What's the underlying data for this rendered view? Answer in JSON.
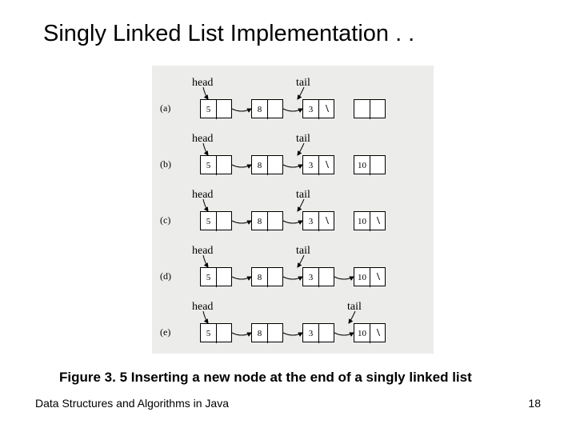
{
  "title": "Singly Linked List Implementation . .",
  "caption": "Figure 3. 5 Inserting a new node at the end of a singly linked list",
  "footer_left": "Data Structures and Algorithms in Java",
  "footer_right": "18",
  "labels": {
    "head_a": "head",
    "tail_a": "tail",
    "head_b": "head",
    "tail_b": "tail",
    "head_c": "head",
    "tail_c": "tail",
    "head_d": "head",
    "tail_d": "tail",
    "head_e": "head",
    "tail_e": "tail"
  },
  "rows": [
    {
      "tag": "(a)",
      "nodes": [
        {
          "v": "5",
          "n": ""
        },
        {
          "v": "8",
          "n": ""
        },
        {
          "v": "3",
          "n": "\\"
        },
        {
          "v": "",
          "n": ""
        }
      ],
      "head_at": 0,
      "tail_at": 2
    },
    {
      "tag": "(b)",
      "nodes": [
        {
          "v": "5",
          "n": ""
        },
        {
          "v": "8",
          "n": ""
        },
        {
          "v": "3",
          "n": "\\"
        },
        {
          "v": "10",
          "n": ""
        }
      ],
      "head_at": 0,
      "tail_at": 2
    },
    {
      "tag": "(c)",
      "nodes": [
        {
          "v": "5",
          "n": ""
        },
        {
          "v": "8",
          "n": ""
        },
        {
          "v": "3",
          "n": "\\"
        },
        {
          "v": "10",
          "n": "\\"
        }
      ],
      "head_at": 0,
      "tail_at": 2
    },
    {
      "tag": "(d)",
      "nodes": [
        {
          "v": "5",
          "n": ""
        },
        {
          "v": "8",
          "n": ""
        },
        {
          "v": "3",
          "n": ""
        },
        {
          "v": "10",
          "n": "\\"
        }
      ],
      "head_at": 0,
      "tail_at": 2
    },
    {
      "tag": "(e)",
      "nodes": [
        {
          "v": "5",
          "n": ""
        },
        {
          "v": "8",
          "n": ""
        },
        {
          "v": "3",
          "n": ""
        },
        {
          "v": "10",
          "n": "\\"
        }
      ],
      "head_at": 0,
      "tail_at": 3
    }
  ],
  "chart_data": {
    "type": "table",
    "title": "Figure 3.5 Inserting a new node at the end of a singly linked list",
    "series": [
      {
        "name": "(a)",
        "values": [
          5,
          8,
          3,
          null
        ],
        "head": "node0",
        "tail": "node2",
        "null_next": [
          "node2"
        ]
      },
      {
        "name": "(b)",
        "values": [
          5,
          8,
          3,
          10
        ],
        "head": "node0",
        "tail": "node2",
        "null_next": [
          "node2"
        ]
      },
      {
        "name": "(c)",
        "values": [
          5,
          8,
          3,
          10
        ],
        "head": "node0",
        "tail": "node2",
        "null_next": [
          "node2",
          "node3"
        ]
      },
      {
        "name": "(d)",
        "values": [
          5,
          8,
          3,
          10
        ],
        "head": "node0",
        "tail": "node2",
        "null_next": [
          "node3"
        ]
      },
      {
        "name": "(e)",
        "values": [
          5,
          8,
          3,
          10
        ],
        "head": "node0",
        "tail": "node3",
        "null_next": [
          "node3"
        ]
      }
    ]
  }
}
